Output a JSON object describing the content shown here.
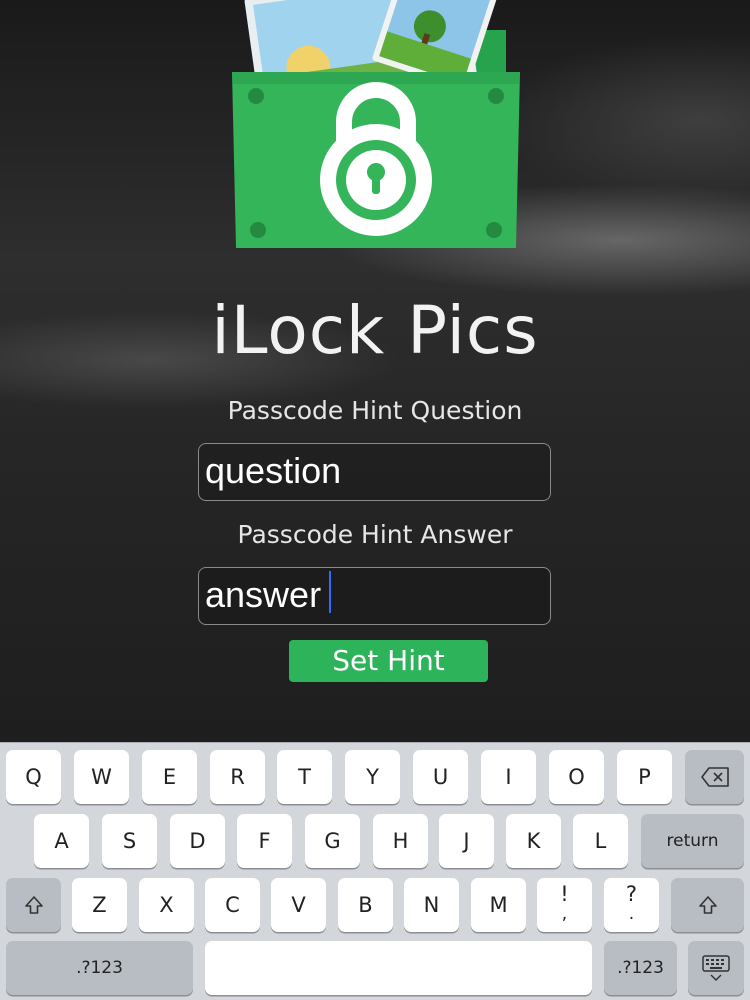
{
  "app": {
    "title": "iLock Pics",
    "accent_color": "#2db45a",
    "logo_icon": "locked-photo-folder-icon"
  },
  "form": {
    "question_label": "Passcode Hint Question",
    "question_value": "question",
    "answer_label": "Passcode Hint Answer",
    "answer_value": "answer",
    "submit_label": "Set Hint"
  },
  "keyboard": {
    "row1": [
      "Q",
      "W",
      "E",
      "R",
      "T",
      "Y",
      "U",
      "I",
      "O",
      "P"
    ],
    "row2": [
      "A",
      "S",
      "D",
      "F",
      "G",
      "H",
      "J",
      "K",
      "L"
    ],
    "row3": [
      "Z",
      "X",
      "C",
      "V",
      "B",
      "N",
      "M"
    ],
    "return_label": "return",
    "numbers_label": ".?123",
    "exclaim_top": "!",
    "exclaim_bottom": ",",
    "question_top": "?",
    "question_bottom": ".",
    "backspace_icon": "backspace-icon",
    "shift_icon": "shift-icon",
    "dismiss_icon": "keyboard-dismiss-icon"
  }
}
